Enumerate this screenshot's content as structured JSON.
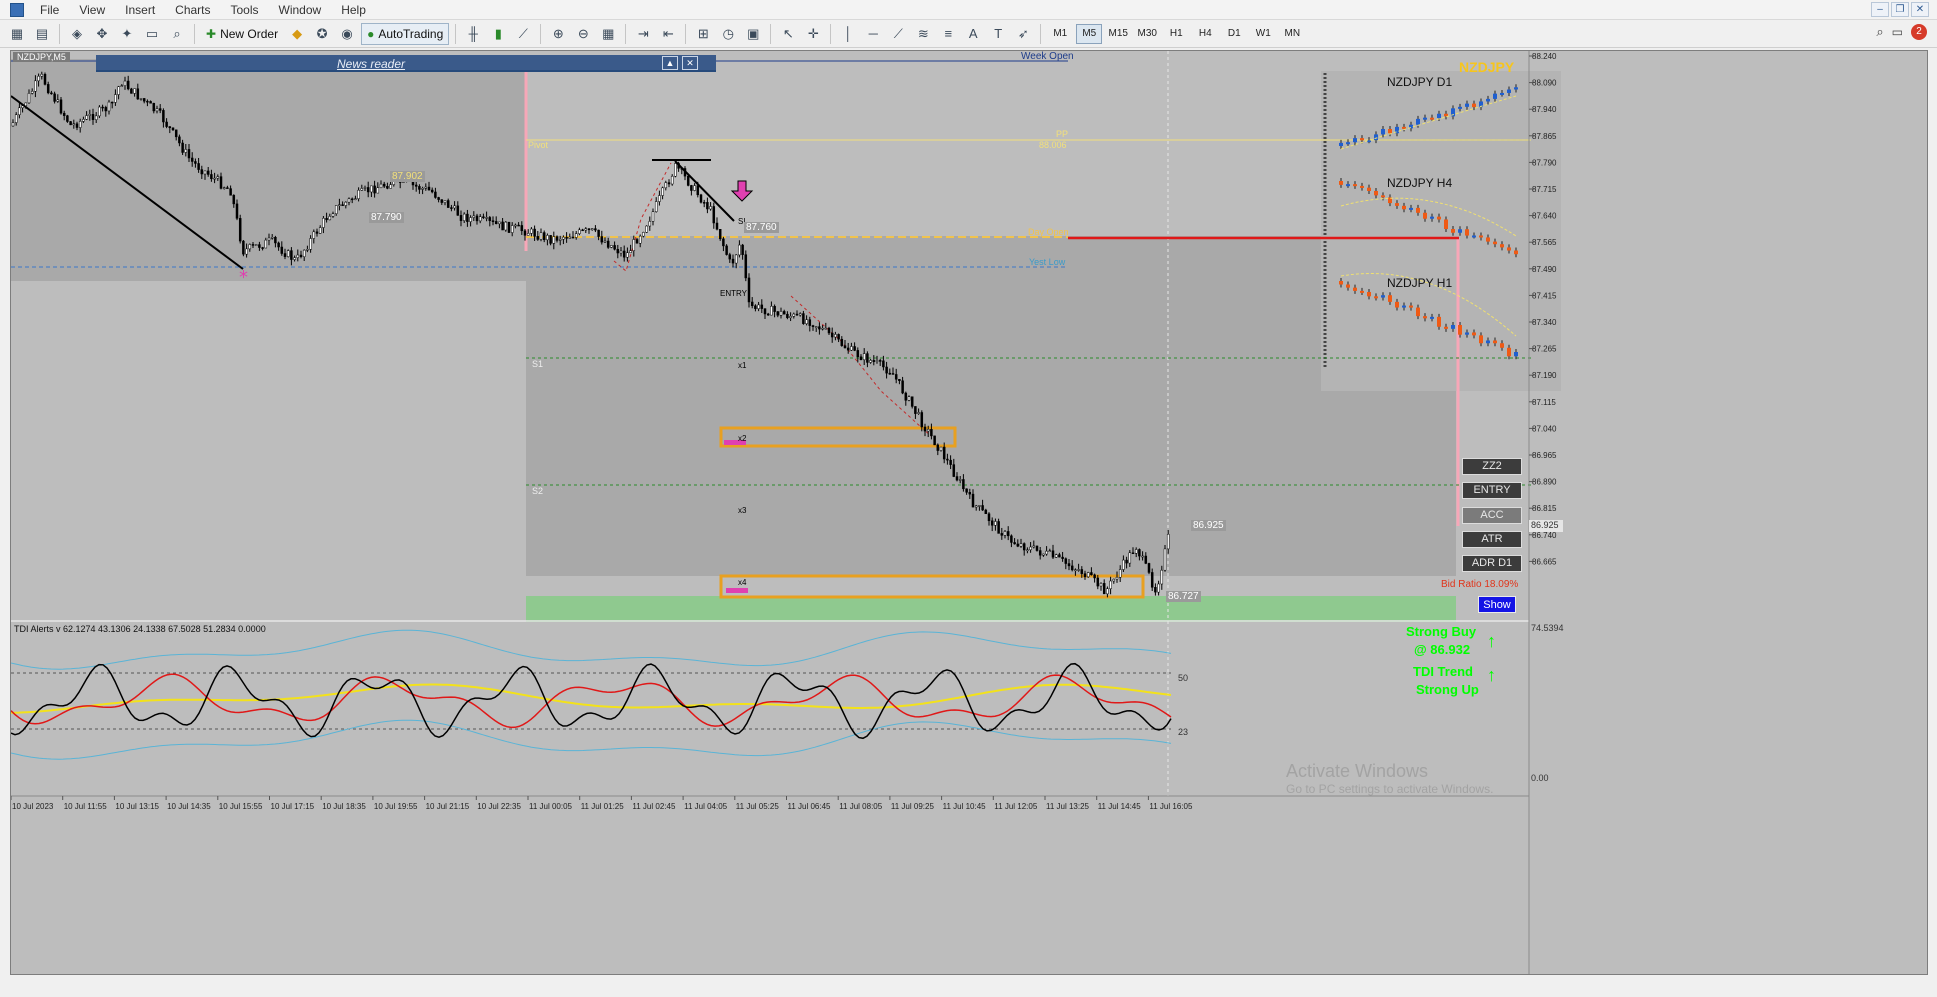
{
  "menu": [
    "File",
    "View",
    "Insert",
    "Charts",
    "Tools",
    "Window",
    "Help"
  ],
  "toolbar": {
    "new_order": "New Order",
    "autotrading": "AutoTrading",
    "timeframes": [
      "M1",
      "M5",
      "M15",
      "M30",
      "H1",
      "H4",
      "D1",
      "W1",
      "MN"
    ],
    "active_timeframe": "M5",
    "notifications": "2"
  },
  "chart": {
    "symbol_tab": "NZDJPY,M5",
    "news_reader": "News reader",
    "week_open_label": "Week Open",
    "pivot_label": "Pivot",
    "pp_label": "PP",
    "pp_value": "88.006",
    "day_open_label": "Day Open",
    "yest_low_label": "Yest Low",
    "s1_label": "S1",
    "s2_label": "S2",
    "sl_label": "SL",
    "entry_label": "ENTRY",
    "x1": "x1",
    "x2": "x2",
    "x3": "x3",
    "x4": "x4",
    "price_tag_1": "87.902",
    "price_tag_2": "87.790",
    "price_tag_3": "87.760",
    "price_tag_4": "86.925",
    "price_tag_5": "86.727",
    "symbol_big": "NZDJPY",
    "panel_d1": "NZDJPY D1",
    "panel_h4": "NZDJPY H4",
    "panel_h1": "NZDJPY H1",
    "side_buttons": [
      "ZZ2",
      "ENTRY",
      "ACC",
      "ATR",
      "ADR D1"
    ],
    "bid_ratio": "Bid Ratio 18.09%",
    "show_button": "Show",
    "price_axis": [
      "88.240",
      "88.090",
      "87.940",
      "87.865",
      "87.790",
      "87.715",
      "87.640",
      "87.565",
      "87.490",
      "87.415",
      "87.340",
      "87.265",
      "87.190",
      "87.115",
      "87.040",
      "86.965",
      "86.890",
      "86.815",
      "86.740",
      "86.665"
    ],
    "current_price": "86.925",
    "time_axis": [
      "10 Jul 2023",
      "10 Jul 11:55",
      "10 Jul 13:15",
      "10 Jul 14:35",
      "10 Jul 15:55",
      "10 Jul 17:15",
      "10 Jul 18:35",
      "10 Jul 19:55",
      "10 Jul 21:15",
      "10 Jul 22:35",
      "11 Jul 00:05",
      "11 Jul 01:25",
      "11 Jul 02:45",
      "11 Jul 04:05",
      "11 Jul 05:25",
      "11 Jul 06:45",
      "11 Jul 08:05",
      "11 Jul 09:25",
      "11 Jul 10:45",
      "11 Jul 12:05",
      "11 Jul 13:25",
      "11 Jul 14:45",
      "11 Jul 16:05"
    ]
  },
  "indicator": {
    "header": "TDI Alerts v 62.1274 43.1306 24.1338 67.5028 51.2834 0.0000",
    "level_50": "50",
    "level_23": "23",
    "axis_top": "74.5394",
    "axis_bottom": "0.00",
    "signal_1": "Strong Buy",
    "signal_1_price": "@ 86.932",
    "signal_2": "TDI Trend",
    "signal_2_sub": "Strong Up"
  },
  "watermark": {
    "line1": "Activate Windows",
    "line2": "Go to PC settings to activate Windows."
  },
  "colors": {
    "chart_bg": "#bdbdbd",
    "shade_dark": "#a9a9a9",
    "pivot": "#f2e07a",
    "red_line": "#e01818",
    "green_zone": "#8fc98f",
    "orange_box": "#e8a020",
    "magenta": "#e040b0",
    "bull_candle": "#1f5fd0",
    "bear_candle": "#f05a14",
    "signal_green": "#00ff00"
  }
}
